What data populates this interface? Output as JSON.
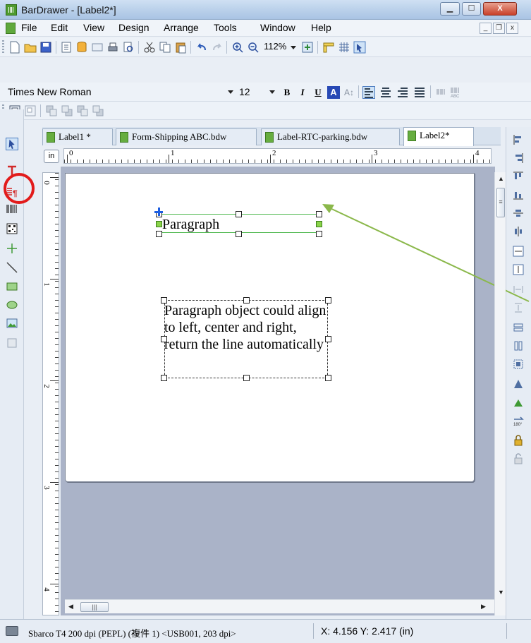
{
  "window": {
    "title": "BarDrawer - [Label2*]",
    "minimize": "▁",
    "maximize": "☐",
    "close": "X"
  },
  "menu": {
    "items": [
      "File",
      "Edit",
      "View",
      "Design",
      "Arrange",
      "Tools",
      "Window",
      "Help"
    ],
    "mdi_min": "_",
    "mdi_restore": "❐",
    "mdi_close": "x"
  },
  "toolbar": {
    "zoom": "112%"
  },
  "format_bar": {
    "font_family": "Times New Roman",
    "font_size": "12",
    "bold": "B",
    "italic": "I",
    "underline": "U",
    "color": "A",
    "text_fit": "A↕"
  },
  "tabs": [
    {
      "label": "Label1 *"
    },
    {
      "label": "Form-Shipping ABC.bdw"
    },
    {
      "label": "Label-RTC-parking.bdw"
    },
    {
      "label": "Label2*"
    }
  ],
  "ruler": {
    "unit": "in",
    "h_numbers": [
      "0",
      "1",
      "2",
      "3",
      "4"
    ],
    "v_numbers": [
      "0",
      "1",
      "2",
      "3",
      "4"
    ]
  },
  "canvas": {
    "paragraph1_text": "Paragraph",
    "paragraph2_text": "Paragraph object could align to left, center and right, return the line automatically"
  },
  "scroll": {
    "up": "▲",
    "down": "▼",
    "left": "◀",
    "right": "▶",
    "grip": "|||",
    "vgrip": "≡"
  },
  "status": {
    "printer": "Sbarco T4 200 dpi (PEPL) (複件 1) <USB001, 203 dpi>",
    "coords": "X: 4.156  Y: 2.417 (in)"
  },
  "colors": {
    "annotation_circle": "#e21b1b",
    "annotation_arrow": "#8bb84b",
    "selection_line": "#4fb84f"
  }
}
